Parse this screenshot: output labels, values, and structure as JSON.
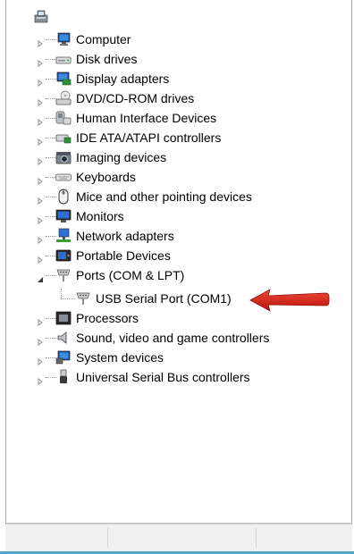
{
  "tree": {
    "items": [
      {
        "label": "Computer",
        "icon": "computer-icon"
      },
      {
        "label": "Disk drives",
        "icon": "disk-drive-icon"
      },
      {
        "label": "Display adapters",
        "icon": "display-adapter-icon"
      },
      {
        "label": "DVD/CD-ROM drives",
        "icon": "dvd-drive-icon"
      },
      {
        "label": "Human Interface Devices",
        "icon": "hid-icon"
      },
      {
        "label": "IDE ATA/ATAPI controllers",
        "icon": "ide-controller-icon"
      },
      {
        "label": "Imaging devices",
        "icon": "camera-icon"
      },
      {
        "label": "Keyboards",
        "icon": "keyboard-icon"
      },
      {
        "label": "Mice and other pointing devices",
        "icon": "mouse-icon"
      },
      {
        "label": "Monitors",
        "icon": "monitor-icon"
      },
      {
        "label": "Network adapters",
        "icon": "network-adapter-icon"
      },
      {
        "label": "Portable Devices",
        "icon": "portable-device-icon"
      },
      {
        "label": "Ports (COM & LPT)",
        "icon": "port-icon",
        "expanded": true
      },
      {
        "label": "USB Serial Port (COM1)",
        "icon": "port-icon",
        "child": true
      },
      {
        "label": "Processors",
        "icon": "processor-icon"
      },
      {
        "label": "Sound, video and game controllers",
        "icon": "speaker-icon"
      },
      {
        "label": "System devices",
        "icon": "system-device-icon"
      },
      {
        "label": "Universal Serial Bus controllers",
        "icon": "usb-icon"
      }
    ]
  },
  "colors": {
    "arrow": "#e01a12",
    "status_accent": "#55a5c5"
  }
}
